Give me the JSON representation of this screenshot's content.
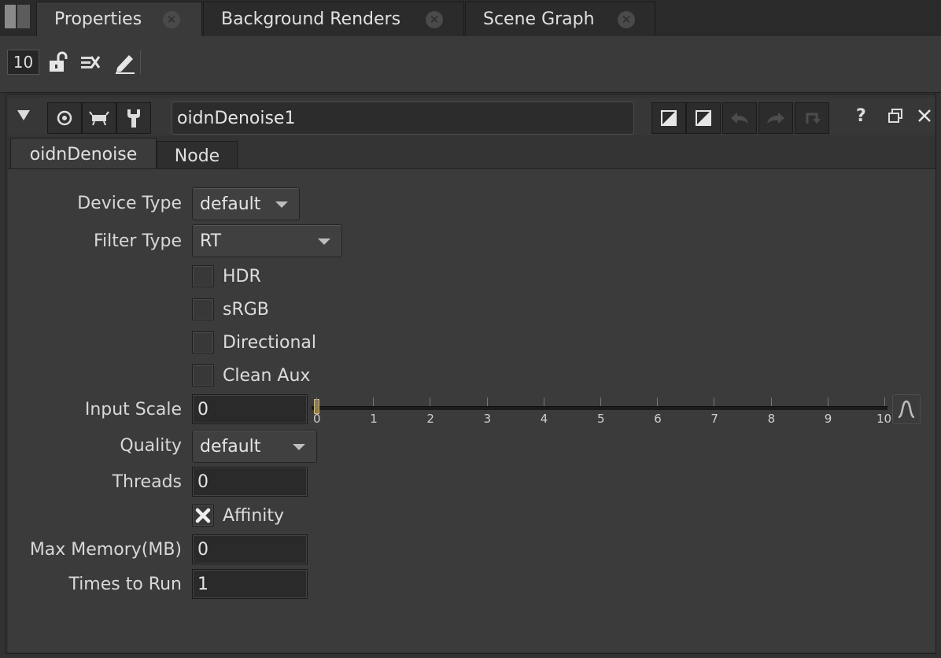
{
  "tabs": [
    {
      "label": "Properties",
      "active": true
    },
    {
      "label": "Background Renders",
      "active": false
    },
    {
      "label": "Scene Graph",
      "active": false
    }
  ],
  "toolbar": {
    "max_panels": "10",
    "icons": [
      "lock-icon",
      "clear-panels-icon",
      "pencil-icon"
    ]
  },
  "node": {
    "name": "oidnDenoise1",
    "header_icons": [
      "collapse-arrow-icon",
      "node-color-icon",
      "viewer-icon",
      "settings-icon"
    ],
    "right_icons": [
      "mix-icon",
      "mix-icon",
      "undo-icon",
      "redo-icon",
      "revert-icon",
      "help-icon",
      "float-icon",
      "close-icon"
    ]
  },
  "panel_tabs": [
    {
      "label": "oidnDenoise",
      "active": true
    },
    {
      "label": "Node",
      "active": false
    }
  ],
  "knobs": {
    "device_type": {
      "label": "Device Type",
      "value": "default"
    },
    "filter_type": {
      "label": "Filter Type",
      "value": "RT"
    },
    "hdr": {
      "label": "HDR",
      "checked": false
    },
    "srgb": {
      "label": "sRGB",
      "checked": false
    },
    "directional": {
      "label": "Directional",
      "checked": false
    },
    "clean_aux": {
      "label": "Clean Aux",
      "checked": false
    },
    "input_scale": {
      "label": "Input Scale",
      "value": "0",
      "slider_ticks": [
        "0",
        "1",
        "2",
        "3",
        "4",
        "5",
        "6",
        "7",
        "8",
        "9",
        "10"
      ],
      "slider_value": 0,
      "slider_range": [
        0,
        10
      ]
    },
    "quality": {
      "label": "Quality",
      "value": "default"
    },
    "threads": {
      "label": "Threads",
      "value": "0"
    },
    "affinity": {
      "label": "Affinity",
      "checked": true
    },
    "max_memory": {
      "label": "Max Memory(MB)",
      "value": "0"
    },
    "times_to_run": {
      "label": "Times to Run",
      "value": "1"
    }
  }
}
